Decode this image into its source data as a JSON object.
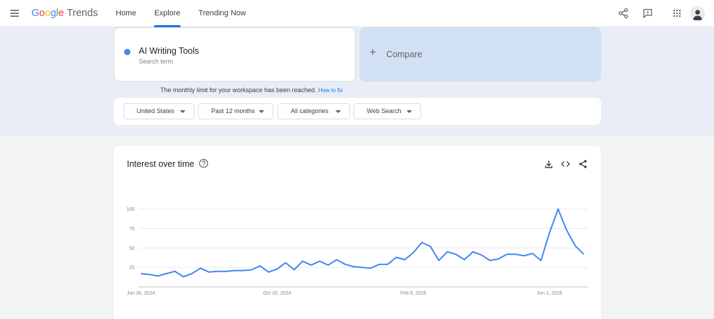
{
  "header": {
    "logo_google": [
      "G",
      "o",
      "o",
      "g",
      "l",
      "e"
    ],
    "logo_trends": "Trends",
    "nav": [
      {
        "label": "Home",
        "active": false
      },
      {
        "label": "Explore",
        "active": true
      },
      {
        "label": "Trending Now",
        "active": false
      }
    ],
    "icons": [
      "menu-icon",
      "share-icon",
      "feedback-icon",
      "apps-grid-icon",
      "account-avatar"
    ]
  },
  "search": {
    "term": "AI Writing Tools",
    "term_sub": "Search term",
    "term_color": "#4285f4",
    "compare_label": "Compare",
    "limit_message": "The monthly limit for your workspace has been reached.",
    "limit_link": "How to fix"
  },
  "filters": {
    "region": "United States",
    "time_range": "Past 12 months",
    "category": "All categories",
    "search_type": "Web Search"
  },
  "chart_card": {
    "title": "Interest over time",
    "action_icons": [
      "download-icon",
      "embed-code-icon",
      "share-icon"
    ]
  },
  "chart_data": {
    "type": "line",
    "title": "Interest over time",
    "series": [
      {
        "name": "AI Writing Tools",
        "color": "#4285f4",
        "values": [
          17,
          16,
          14,
          17,
          20,
          13,
          17,
          24,
          19,
          20,
          20,
          21,
          21,
          22,
          27,
          19,
          23,
          31,
          22,
          33,
          28,
          33,
          28,
          35,
          29,
          26,
          25,
          24,
          29,
          29,
          38,
          35,
          44,
          57,
          52,
          34,
          45,
          42,
          35,
          45,
          41,
          34,
          36,
          42,
          42,
          40,
          43,
          34,
          70,
          100,
          73,
          53,
          42
        ]
      }
    ],
    "x_ticks": [
      "Jun 30, 2024",
      "Oct 20, 2024",
      "Feb 9, 2025",
      "Jun 1, 2025"
    ],
    "x_tick_index": [
      0,
      16,
      32,
      48
    ],
    "y_ticks": [
      25,
      50,
      75,
      100
    ],
    "ylim": [
      0,
      100
    ],
    "grid": true
  }
}
